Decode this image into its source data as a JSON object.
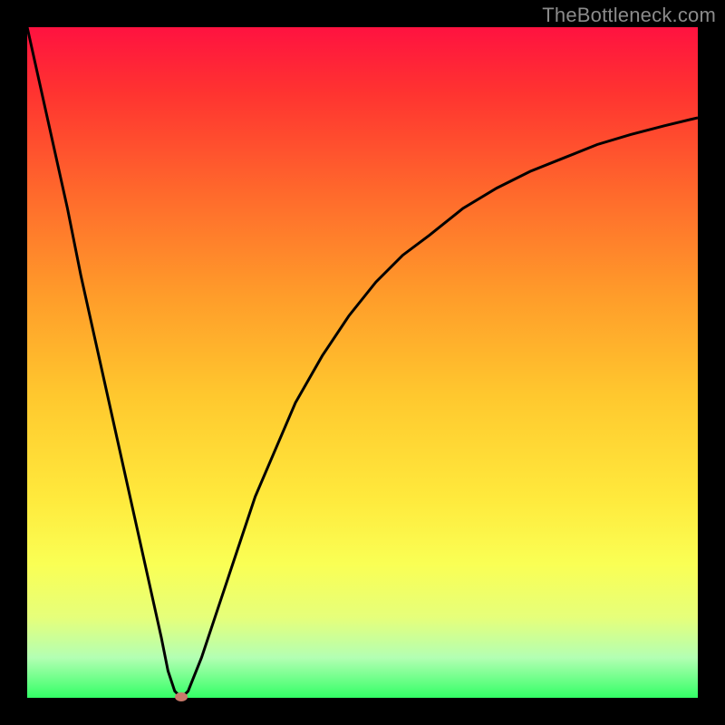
{
  "watermark": "TheBottleneck.com",
  "colors": {
    "frame": "#000000",
    "curve": "#000000",
    "dot": "#c97a6b",
    "gradient_top": "#ff1240",
    "gradient_bottom": "#33ff66"
  },
  "chart_data": {
    "type": "line",
    "title": "",
    "xlabel": "",
    "ylabel": "",
    "xlim": [
      0,
      100
    ],
    "ylim": [
      0,
      100
    ],
    "grid": false,
    "series": [
      {
        "name": "bottleneck-curve",
        "x": [
          0,
          2,
          4,
          6,
          8,
          10,
          12,
          14,
          16,
          18,
          20,
          21,
          22,
          23,
          24,
          26,
          28,
          30,
          32,
          34,
          37,
          40,
          44,
          48,
          52,
          56,
          60,
          65,
          70,
          75,
          80,
          85,
          90,
          95,
          100
        ],
        "values": [
          100,
          91,
          82,
          73,
          63,
          54,
          45,
          36,
          27,
          18,
          9,
          4,
          1,
          0,
          1,
          6,
          12,
          18,
          24,
          30,
          37,
          44,
          51,
          57,
          62,
          66,
          69,
          73,
          76,
          78.5,
          80.5,
          82.5,
          84,
          85.3,
          86.5
        ]
      }
    ],
    "marker": {
      "x": 23,
      "y": 0,
      "name": "optimal-point"
    },
    "annotations": [
      {
        "text": "TheBottleneck.com",
        "position": "top-right"
      }
    ]
  }
}
